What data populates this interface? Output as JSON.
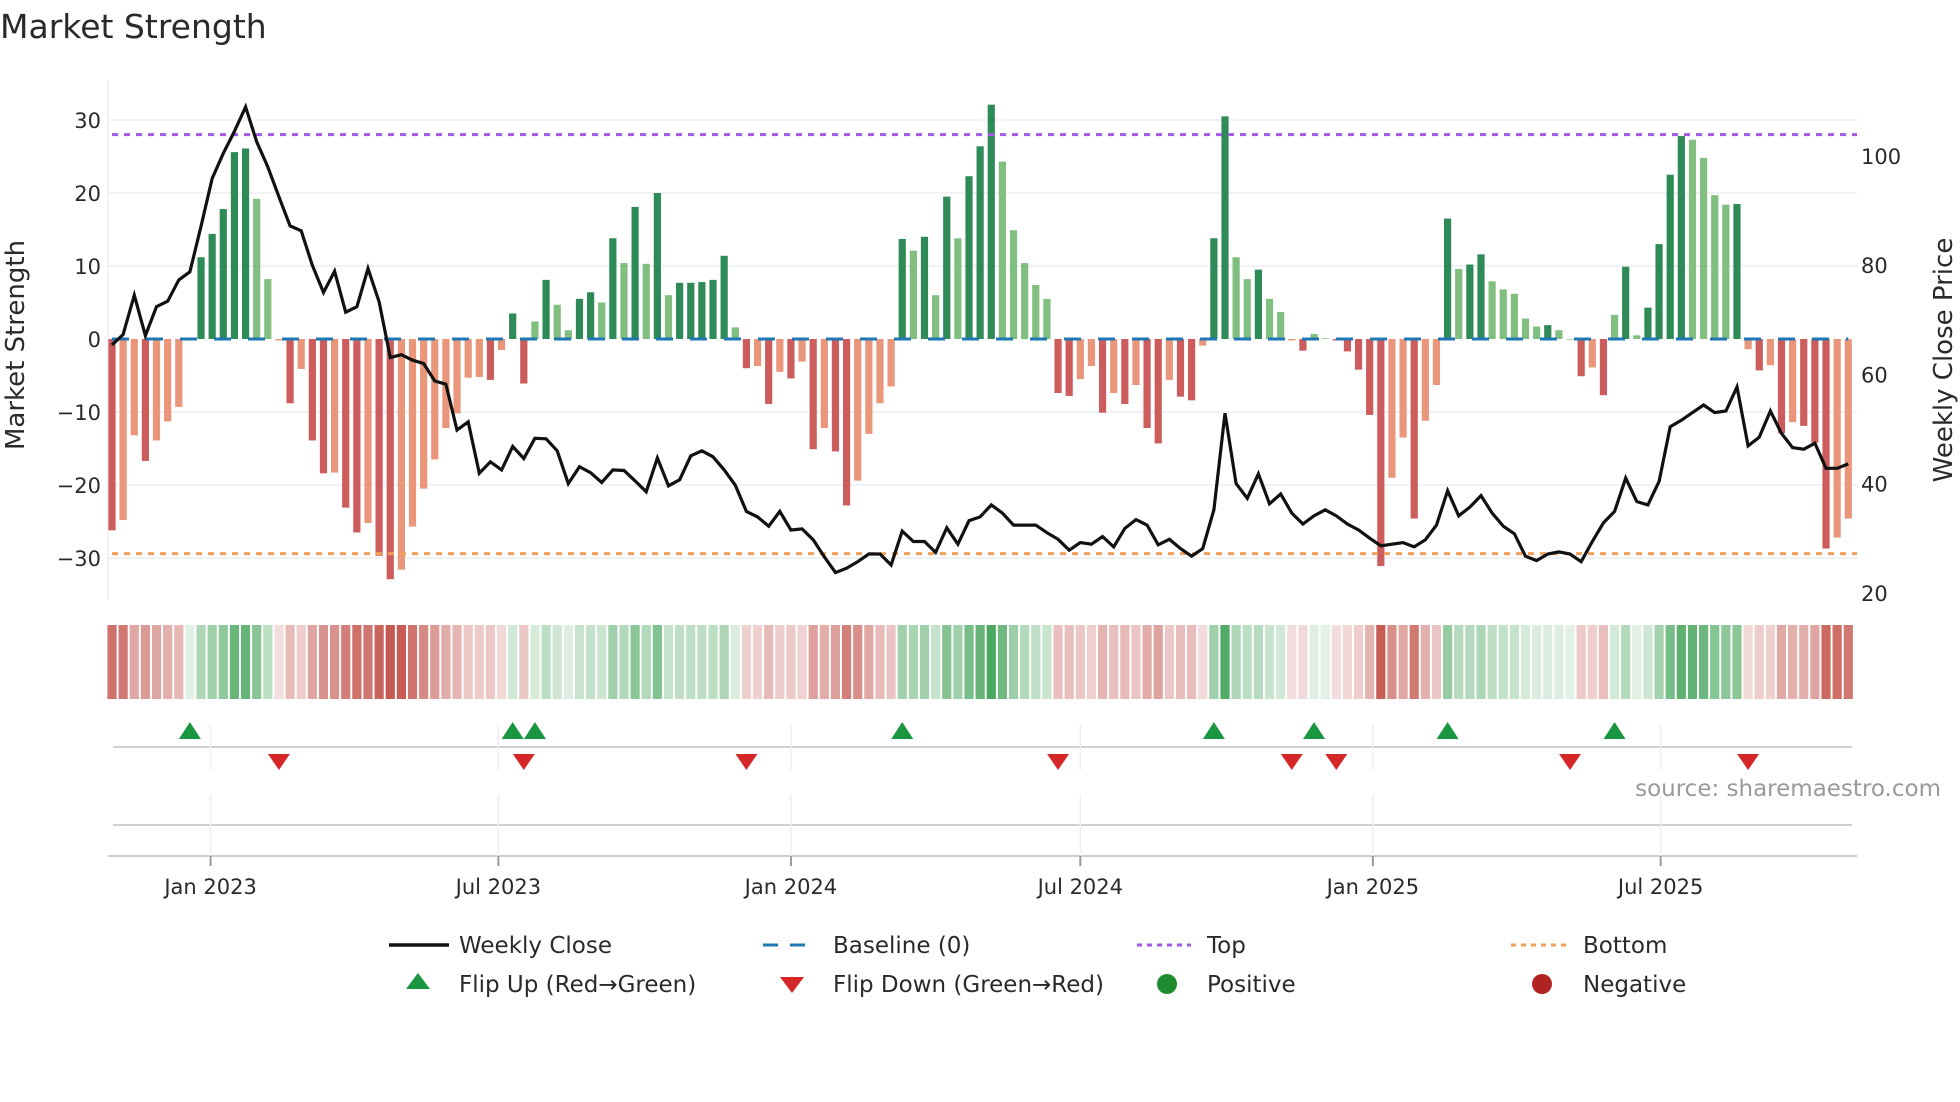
{
  "chart_data": {
    "type": "bar",
    "title": "Market Strength",
    "ylabel": "Market Strength",
    "y2label": "Weekly Close Price",
    "source": "source: sharemaestro.com",
    "start_date": "2022-10-31",
    "frequency": "weekly",
    "ylim": [
      -35,
      35
    ],
    "y2lim": [
      20,
      109
    ],
    "yticks": [
      -30,
      -20,
      -10,
      0,
      10,
      20,
      30
    ],
    "ytick_labels": [
      "−30",
      "−20",
      "−10",
      "0",
      "10",
      "20",
      "30"
    ],
    "y2ticks": [
      20,
      40,
      60,
      80,
      100
    ],
    "y2tick_labels": [
      "20",
      "40",
      "60",
      "80",
      "100"
    ],
    "xticks": [
      {
        "date": "2023-01-01",
        "label": "Jan 2023"
      },
      {
        "date": "2023-07-01",
        "label": "Jul 2023"
      },
      {
        "date": "2024-01-01",
        "label": "Jan 2024"
      },
      {
        "date": "2024-07-01",
        "label": "Jul 2024"
      },
      {
        "date": "2025-01-01",
        "label": "Jan 2025"
      },
      {
        "date": "2025-07-01",
        "label": "Jul 2025"
      }
    ],
    "top_level": 28,
    "bottom_level": -29.4,
    "baseline": 0,
    "grid": true,
    "legend_placement": "bottom-center",
    "strength": [
      -26.2,
      -24.8,
      -13.2,
      -16.7,
      -13.9,
      -11.3,
      -9.3,
      0,
      11.2,
      14.4,
      17.8,
      25.6,
      26.1,
      19.2,
      8.2,
      -0.2,
      -8.8,
      -4.1,
      -13.9,
      -18.4,
      -18.3,
      -23.1,
      -26.5,
      -25.2,
      -29.7,
      -32.9,
      -31.6,
      -25.7,
      -20.5,
      -16.5,
      -12.2,
      -10.2,
      -5.3,
      -5.2,
      -5.6,
      -1.5,
      3.5,
      -6.1,
      2.4,
      8.1,
      4.7,
      1.2,
      5.5,
      6.4,
      5.0,
      13.8,
      10.4,
      18.1,
      10.3,
      20,
      6.0,
      7.7,
      7.7,
      7.8,
      8.1,
      11.4,
      1.6,
      -4.0,
      -3.7,
      -8.9,
      -4.5,
      -5.4,
      -3.1,
      -15.1,
      -12.2,
      -15.4,
      -22.8,
      -19.4,
      -13,
      -8.8,
      -6.5,
      13.7,
      12.1,
      14,
      6.0,
      19.5,
      13.8,
      22.3,
      26.4,
      32.1,
      24.3,
      14.9,
      10.4,
      7.4,
      5.5,
      -7.4,
      -7.8,
      -5.5,
      -3.7,
      -10.1,
      -7.4,
      -8.9,
      -6.3,
      -12.2,
      -14.3,
      -5.6,
      -7.9,
      -8.4,
      -0.9,
      13.8,
      30.5,
      11.2,
      8.2,
      9.5,
      5.5,
      3.7,
      -0.2,
      -1.6,
      0.7,
      0.1,
      -0.2,
      -1.7,
      -4.2,
      -10.4,
      -31.1,
      -19,
      -13.5,
      -24.6,
      -11.2,
      -6.3,
      16.5,
      9.6,
      10.2,
      11.6,
      7.9,
      6.8,
      6.2,
      2.8,
      1.7,
      1.9,
      1.2,
      0,
      -5.1,
      -3.9,
      -7.7,
      3.3,
      9.9,
      0.5,
      4.3,
      13,
      22.5,
      27.8,
      27.3,
      24.8,
      19.7,
      18.4,
      18.5,
      -1.4,
      -4.3,
      -3.6,
      -12.9,
      -11.4,
      -11.9,
      -14.2,
      -28.7,
      -27.2,
      -24.6
    ],
    "weekly_close": [
      65.4,
      67.3,
      74.5,
      67.1,
      72.4,
      73.4,
      77.3,
      78.8,
      87.1,
      95.9,
      100.5,
      104.5,
      109,
      102.6,
      98,
      92.5,
      87.2,
      86.3,
      80,
      75,
      78.9,
      71.4,
      72.4,
      79.4,
      73.3,
      63.1,
      63.6,
      62.6,
      62,
      58.8,
      58.2,
      49.8,
      51.3,
      41.9,
      44,
      42.5,
      46.8,
      44.6,
      48.3,
      48.2,
      46,
      40,
      43.1,
      42,
      40.2,
      42.5,
      42.4,
      40.5,
      38.5,
      44.7,
      39.6,
      40.7,
      45.1,
      46,
      44.9,
      42.5,
      39.7,
      34.9,
      33.9,
      32.2,
      34.9,
      31.5,
      31.7,
      29.7,
      26.6,
      23.7,
      24.5,
      25.7,
      27.1,
      27.1,
      25.1,
      31.3,
      29.4,
      29.4,
      27.4,
      31.9,
      28.9,
      33.2,
      33.9,
      36.1,
      34.6,
      32.4,
      32.4,
      32.4,
      31,
      29.8,
      27.8,
      29.2,
      28.9,
      30.3,
      28.4,
      31.8,
      33.4,
      32.4,
      28.8,
      29.8,
      28.1,
      26.7,
      28.1,
      35.2,
      52.9,
      40,
      37.3,
      41.8,
      36.3,
      38.1,
      34.6,
      32.6,
      34.1,
      35.2,
      34.1,
      32.6,
      31.5,
      30,
      28.6,
      28.9,
      29.2,
      28.4,
      29.7,
      32.4,
      38.7,
      34.1,
      35.7,
      37.8,
      34.6,
      32.2,
      30.8,
      26.7,
      25.9,
      27.1,
      27.5,
      27.1,
      25.7,
      29.4,
      32.8,
      34.9,
      41,
      36.7,
      36.1,
      40.4,
      50.4,
      51.6,
      53,
      54.4,
      53,
      53.3,
      57.7,
      46.9,
      48.5,
      53.3,
      49.2,
      46.6,
      46.3,
      47.4,
      42.8,
      42.8,
      43.6
    ],
    "flip_up_weeks": [
      7,
      36,
      38,
      71,
      99,
      108,
      120,
      135
    ],
    "flip_down_weeks": [
      15,
      37,
      57,
      85,
      106,
      110,
      131,
      147
    ],
    "legend": [
      {
        "key": "close",
        "label": "Weekly Close"
      },
      {
        "key": "baseline",
        "label": "Baseline (0)"
      },
      {
        "key": "top",
        "label": "Top"
      },
      {
        "key": "bottom",
        "label": "Bottom"
      },
      {
        "key": "flip_up",
        "label": "Flip Up (Red→Green)"
      },
      {
        "key": "flip_down",
        "label": "Flip Down (Green→Red)"
      },
      {
        "key": "positive",
        "label": "Positive"
      },
      {
        "key": "negative",
        "label": "Negative"
      }
    ],
    "colors": {
      "pos_strong": "#2e8b57",
      "pos_weak": "#80bf80",
      "neg_strong": "#cd5c5c",
      "neg_weak": "#e9967a",
      "line": "#111111",
      "baseline": "#1f77b4",
      "top": "#a259e6",
      "bottom": "#f0a05a",
      "flip_up": "#1a9641",
      "flip_down": "#d62728",
      "positive_dot": "#1e8c2e",
      "negative_dot": "#b22222",
      "heat_pos": "#4aa860",
      "heat_neg": "#c65a52"
    }
  }
}
